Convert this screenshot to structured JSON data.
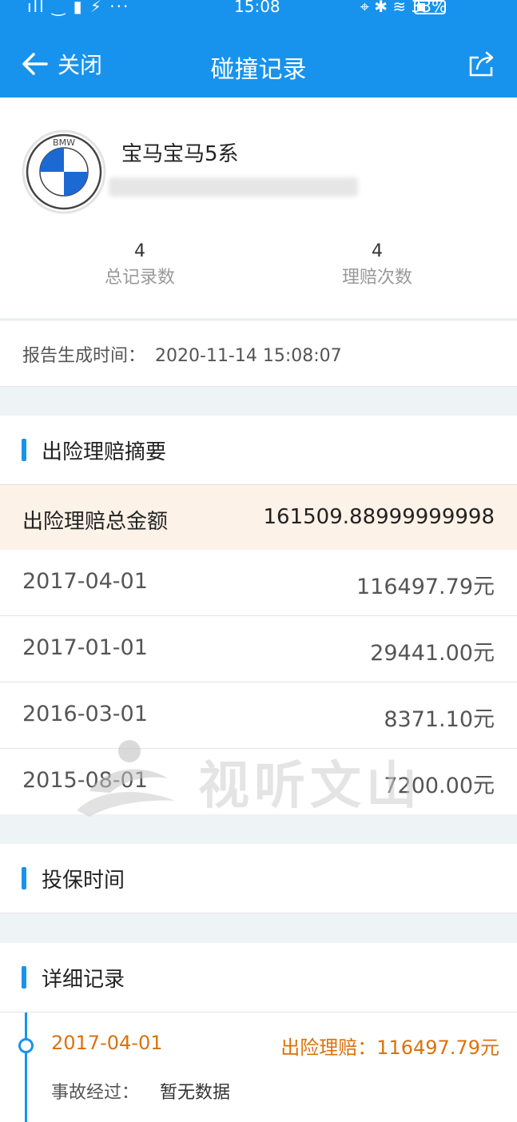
{
  "status_bar": {
    "left": "ıll ‿ ▮ ⚡ ···",
    "time": "15:08",
    "right": "⌖ ✱ ≋ 33%"
  },
  "nav": {
    "back_label": "关闭",
    "title": "碰撞记录"
  },
  "car": {
    "name": "宝马宝马5系",
    "logo_text": "BMW",
    "stats": [
      {
        "value": "4",
        "label": "总记录数"
      },
      {
        "value": "4",
        "label": "理赔次数"
      }
    ]
  },
  "report": {
    "label": "报告生成时间：",
    "value": "2020-11-14 15:08:07"
  },
  "summary": {
    "title": "出险理赔摘要",
    "total_label": "出险理赔总金额",
    "total_value": "161509.88999999998",
    "rows": [
      {
        "date": "2017-04-01",
        "amount": "116497.79元"
      },
      {
        "date": "2017-01-01",
        "amount": "29441.00元"
      },
      {
        "date": "2016-03-01",
        "amount": "8371.10元"
      },
      {
        "date": "2015-08-01",
        "amount": "7200.00元"
      }
    ]
  },
  "insure": {
    "title": "投保时间"
  },
  "details": {
    "title": "详细记录",
    "items": [
      {
        "date": "2017-04-01",
        "claim": "出险理赔：116497.79元",
        "accident_label": "事故经过：",
        "accident_value": "暂无数据"
      }
    ]
  },
  "watermark": {
    "text": "视听文山"
  },
  "colors": {
    "primary": "#1793ee",
    "accent": "#d9730d",
    "highlight_bg": "#fdf2e8"
  }
}
